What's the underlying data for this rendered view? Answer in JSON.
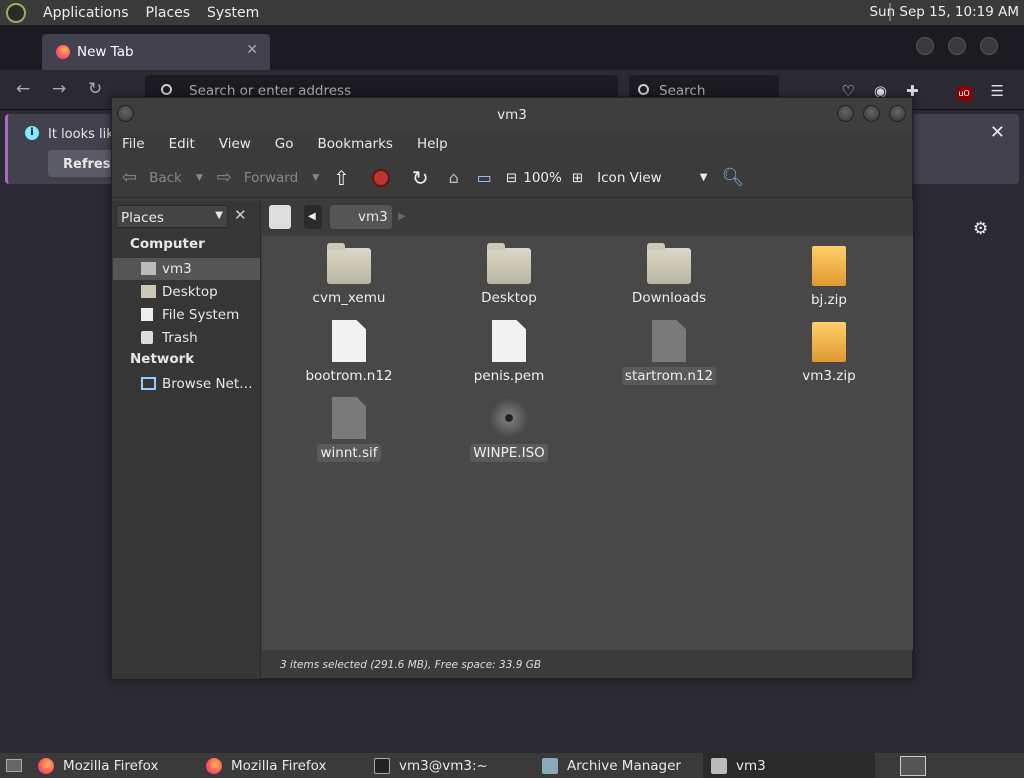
{
  "topbar": {
    "menus": [
      "Applications",
      "Places",
      "System"
    ],
    "clock": "Sun Sep 15, 10:19 AM"
  },
  "firefox": {
    "tab_title": "New Tab",
    "url_placeholder": "Search or enter address",
    "search_placeholder": "Search",
    "notice_text": "It looks like",
    "refresh_label": "Refresh"
  },
  "fm": {
    "title": "vm3",
    "menu": [
      "File",
      "Edit",
      "View",
      "Go",
      "Bookmarks",
      "Help"
    ],
    "toolbar": {
      "back": "Back",
      "forward": "Forward",
      "zoom": "100%",
      "view_mode": "Icon View"
    },
    "places_label": "Places",
    "sidebar": {
      "computer_header": "Computer",
      "network_header": "Network",
      "items": [
        "vm3",
        "Desktop",
        "File System",
        "Trash"
      ],
      "network_items": [
        "Browse Net…"
      ]
    },
    "path": "vm3",
    "files": [
      {
        "name": "cvm_xemu",
        "type": "folder",
        "selected": false
      },
      {
        "name": "Desktop",
        "type": "folder",
        "selected": false
      },
      {
        "name": "Downloads",
        "type": "folder",
        "selected": false
      },
      {
        "name": "bj.zip",
        "type": "zip",
        "selected": false
      },
      {
        "name": "bootrom.n12",
        "type": "doc",
        "selected": false
      },
      {
        "name": "penis.pem",
        "type": "doc",
        "selected": false
      },
      {
        "name": "startrom.n12",
        "type": "gdoc",
        "selected": true
      },
      {
        "name": "vm3.zip",
        "type": "zip",
        "selected": false
      },
      {
        "name": "winnt.sif",
        "type": "gdoc",
        "selected": true
      },
      {
        "name": "WINPE.ISO",
        "type": "disc",
        "selected": true
      }
    ],
    "status": "3 items selected (291.6 MB), Free space: 33.9 GB"
  },
  "taskbar": {
    "items": [
      "Mozilla Firefox",
      "Mozilla Firefox",
      "vm3@vm3:~",
      "Archive Manager",
      "vm3"
    ]
  }
}
